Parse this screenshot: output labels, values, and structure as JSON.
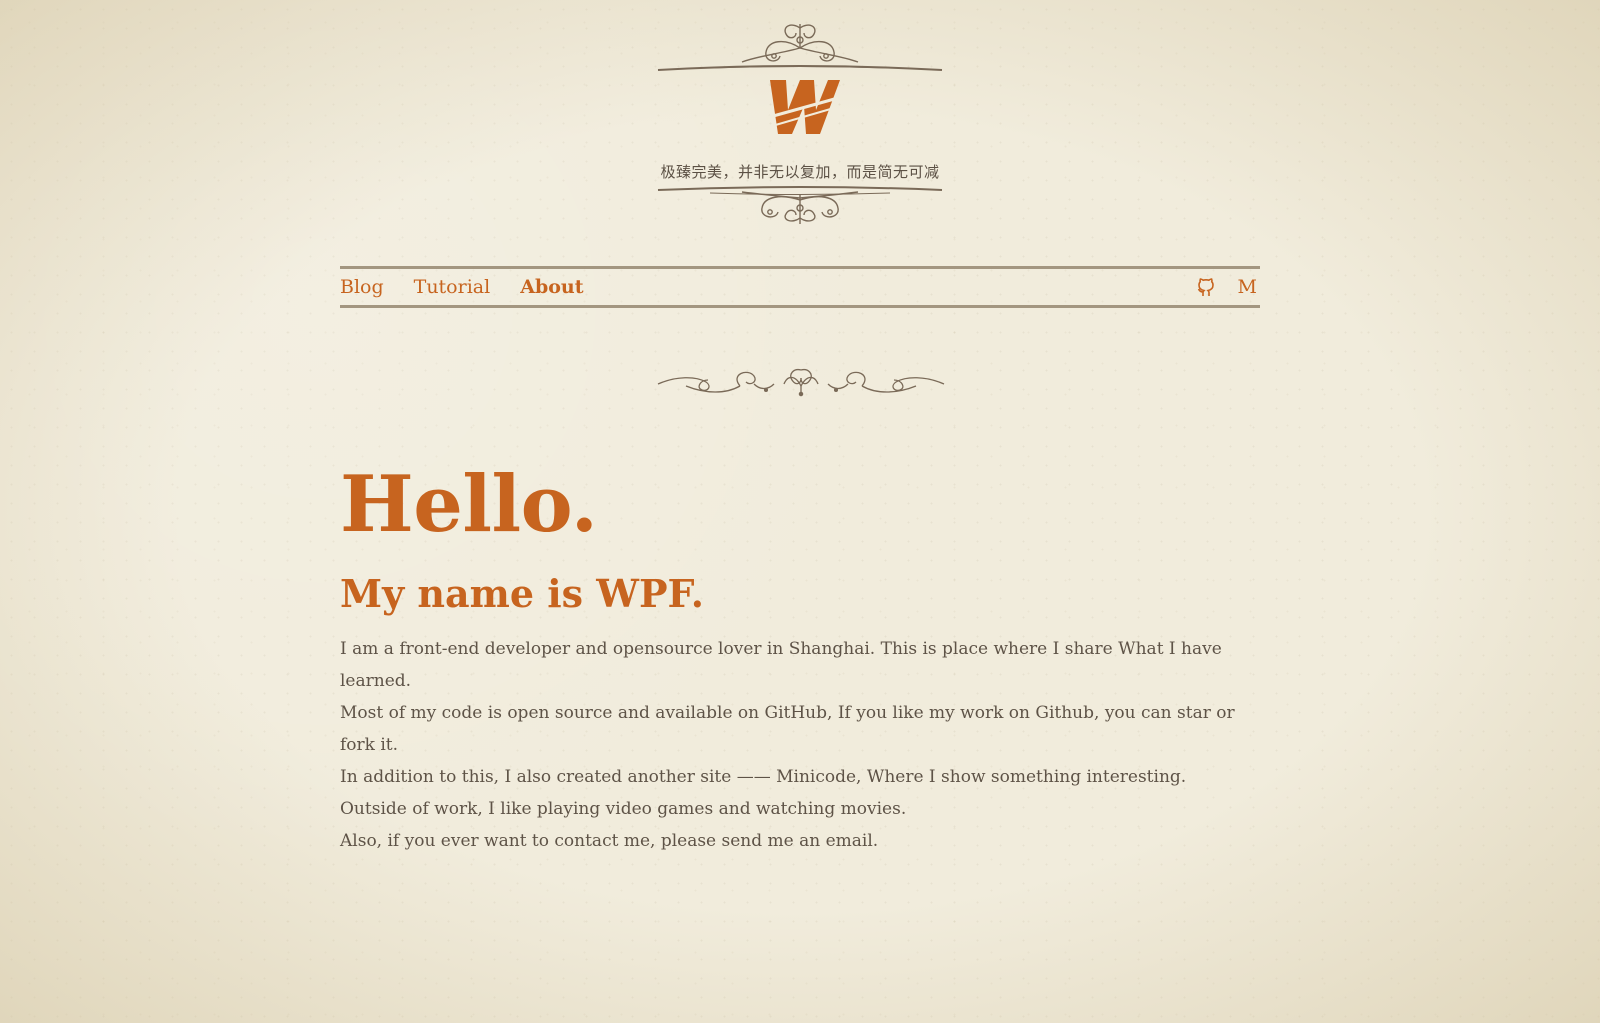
{
  "site": {
    "logo_letter": "W",
    "tagline": "极臻完美，并非无以复加，而是简无可减"
  },
  "nav": {
    "items": [
      {
        "label": "Blog",
        "active": false
      },
      {
        "label": "Tutorial",
        "active": false
      },
      {
        "label": "About",
        "active": true
      }
    ],
    "icons": [
      {
        "name": "github-icon"
      },
      {
        "name": "medium-icon",
        "label": "M"
      }
    ]
  },
  "content": {
    "heading": "Hello.",
    "subheading": "My name is WPF.",
    "paragraphs": [
      "I am a front-end developer and opensource lover in Shanghai. This is place where I share What I have learned.",
      "Most of my code is open source and available on GitHub, If you like my work on Github, you can star or fork it.",
      "In addition to this, I also created another site —— Minicode, Where I show something interesting.",
      "Outside of work, I like playing video games and watching movies.",
      "Also, if you ever want to contact me, please send me an email."
    ]
  },
  "colors": {
    "accent": "#c7641f",
    "text": "#5e5347",
    "rule": "#a39680",
    "background": "#f1ecdc"
  }
}
